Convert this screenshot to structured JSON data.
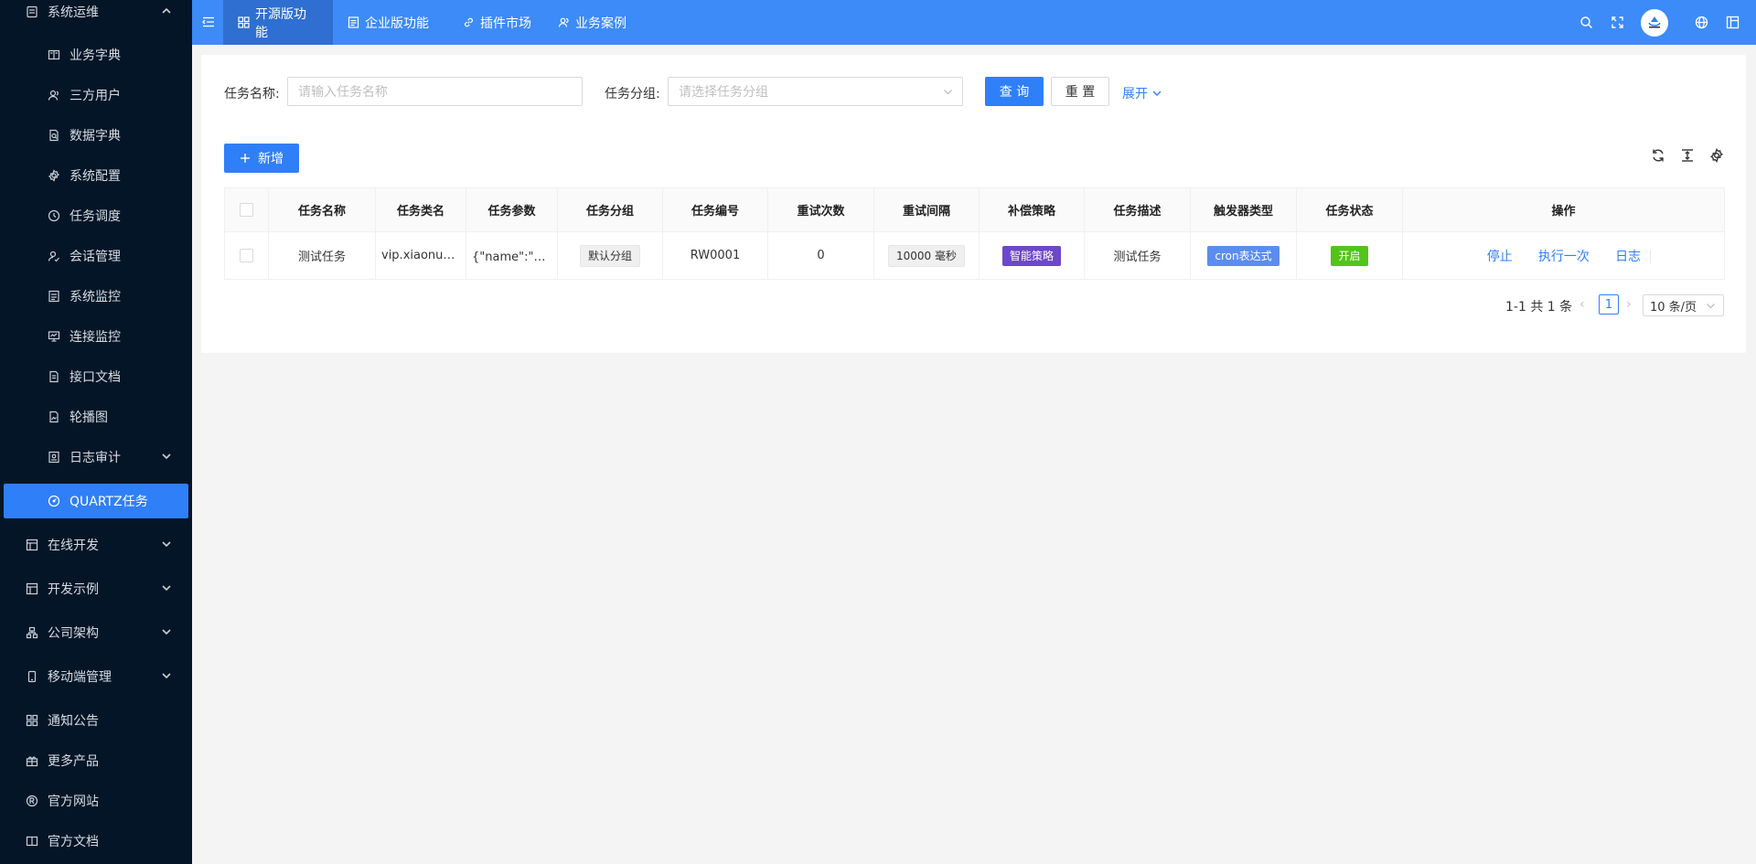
{
  "sidebar": {
    "group_title": "系统运维",
    "sub_items": [
      {
        "label": "业务字典",
        "icon": "book-icon"
      },
      {
        "label": "三方用户",
        "icon": "users-icon"
      },
      {
        "label": "数据字典",
        "icon": "file-search-icon"
      },
      {
        "label": "系统配置",
        "icon": "gear-icon"
      },
      {
        "label": "任务调度",
        "icon": "clock-icon"
      },
      {
        "label": "会话管理",
        "icon": "session-icon"
      },
      {
        "label": "系统监控",
        "icon": "monitor-icon"
      },
      {
        "label": "连接监控",
        "icon": "connection-icon"
      },
      {
        "label": "接口文档",
        "icon": "doc-icon"
      },
      {
        "label": "轮播图",
        "icon": "image-icon"
      },
      {
        "label": "日志审计",
        "icon": "log-icon"
      }
    ],
    "active_item": "QUARTZ任务",
    "groups": [
      {
        "label": "在线开发"
      },
      {
        "label": "开发示例"
      },
      {
        "label": "公司架构"
      },
      {
        "label": "移动端管理"
      }
    ],
    "bottom_items": [
      {
        "label": "通知公告"
      },
      {
        "label": "更多产品"
      },
      {
        "label": "官方网站"
      },
      {
        "label": "官方文档"
      }
    ]
  },
  "topbar": {
    "tabs": [
      {
        "label": "开源版功能"
      },
      {
        "label": "企业版功能"
      },
      {
        "label": "插件市场"
      },
      {
        "label": "业务案例"
      }
    ]
  },
  "search": {
    "name_label": "任务名称:",
    "name_placeholder": "请输入任务名称",
    "group_label": "任务分组:",
    "group_placeholder": "请选择任务分组",
    "query_label": "查 询",
    "reset_label": "重 置",
    "expand_label": "展开"
  },
  "toolbar": {
    "add_label": "新增"
  },
  "table": {
    "headers": [
      "任务名称",
      "任务类名",
      "任务参数",
      "任务分组",
      "任务编号",
      "重试次数",
      "重试间隔",
      "补偿策略",
      "任务描述",
      "触发器类型",
      "任务状态",
      "操作"
    ],
    "rows": [
      {
        "name": "测试任务",
        "class_name": "vip.xiaonuo.biz.modular.quartz.task.TestTask",
        "params": "{\"name\":\"张三\"}",
        "group": "默认分组",
        "code": "RW0001",
        "retry_count": "0",
        "retry_interval": "10000 毫秒",
        "strategy": "智能策略",
        "description": "测试任务",
        "trigger": "cron表达式",
        "status": "开启",
        "actions": [
          "停止",
          "执行一次",
          "日志"
        ]
      }
    ]
  },
  "pagination": {
    "summary": "1-1 共 1 条",
    "current": "1",
    "page_size": "10 条/页"
  },
  "colors": {
    "sidebar_bg": "#041527",
    "topbar_bg": "#3d8bf8",
    "primary": "#2f7ff8"
  }
}
